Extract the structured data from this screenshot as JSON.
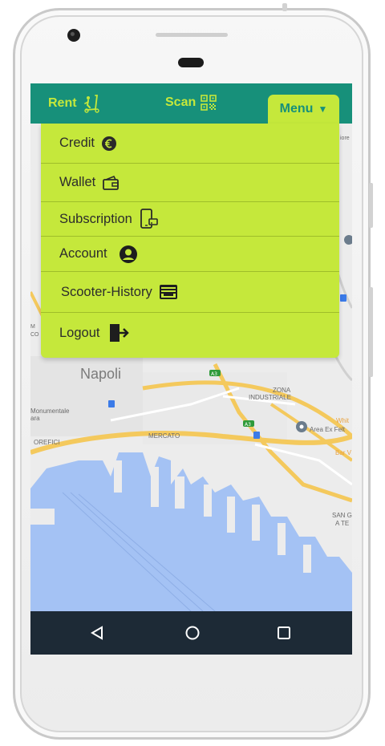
{
  "app": {
    "tabs": {
      "rent": "Rent",
      "scan": "Scan",
      "menu": "Menu"
    },
    "menu_arrow": "▼",
    "colors": {
      "primary": "#17907a",
      "accent": "#c5e83b",
      "navbar": "#1d2a36",
      "water": "#a4c2f4"
    }
  },
  "menu": {
    "items": [
      {
        "label": "Credit",
        "icon": "euro-coin-icon"
      },
      {
        "label": "Wallet",
        "icon": "wallet-icon"
      },
      {
        "label": "Subscription",
        "icon": "phone-card-icon"
      },
      {
        "label": "Account",
        "icon": "user-circle-icon"
      },
      {
        "label": "Scooter-History",
        "icon": "history-card-icon"
      },
      {
        "label": "Logout",
        "icon": "logout-icon"
      }
    ]
  },
  "map": {
    "labels": {
      "city": "Napoli",
      "zona": "ZONA",
      "industriale": "INDUSTRIALE",
      "mercato": "MERCATO",
      "monumentale": "Monumentale",
      "ara": "ara",
      "orefici": "OREFICI",
      "area_ex": "Area Ex Felt",
      "white": "Whit",
      "bar": "Bar V",
      "san": "SAN G",
      "ate": "A TE",
      "highway_a3": "A3",
      "fiore": "iore",
      "mc": "M",
      "co": "CO"
    }
  },
  "navbar": {
    "back": "back-icon",
    "home": "home-icon",
    "recent": "recent-apps-icon"
  }
}
